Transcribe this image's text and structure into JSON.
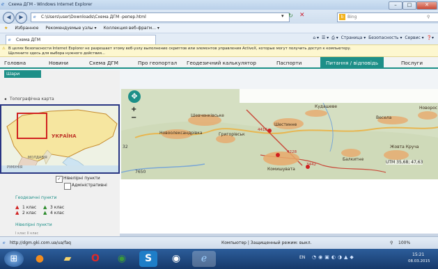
{
  "browser": {
    "title": "Схема ДГМ - Windows Internet Explorer",
    "url": "C:\\Users\\user\\Downloads\\Схема ДГМ -репер.html",
    "search_placeholder": "Bing",
    "favorites_label": "Избранное",
    "favorites_items": [
      "Рекомендуемые узлы ▾",
      "Коллекция веб-фрагм... ▾"
    ],
    "tab_title": "Схема ДГМ",
    "command_bar": [
      "Страница ▾",
      "Безопасность ▾",
      "Сервис ▾"
    ],
    "infobar_line1": "В целях безопасности Internet Explorer не разрешает этому веб-узлу выполнение скриптов или элементов управления ActiveX, которые могут получить доступ к компьютеру.",
    "infobar_line2": "Щелкните здесь для выбора нужного действия..."
  },
  "menu": {
    "items": [
      "Головна",
      "Новини",
      "Схема ДГМ",
      "Про геопортал",
      "Геодезичний калькулятор",
      "Паспорти",
      "Питання / відповідь",
      "Послуги"
    ],
    "active_index": 6
  },
  "sidebar": {
    "top_button": "Шари",
    "section": "Топографічна карта",
    "overview_label": "УКРАЇНА",
    "overview_labels": [
      "МОЛДАВІЯ",
      "РУМУНІЯ"
    ],
    "checkbox_1": "Нівелірні пункти",
    "checkbox_2": "Адміністративні",
    "legend_geo_title": "Геодезичні пункти",
    "legend_geo": [
      "1 клас",
      "3 клас",
      "2 клас",
      "4 клас"
    ],
    "legend_level_title": "Нівелірні пункти",
    "legend_level_cut": "I клас   II клас"
  },
  "map": {
    "places": [
      "Шевченківське",
      "Новоолександрівка",
      "Григорівськ",
      "Шестинне",
      "Кудашеве",
      "Весела",
      "Новорос",
      "Жовта Круча",
      "Комишувата",
      "Балкитне"
    ],
    "marks": [
      "4416",
      "4228",
      "3442"
    ],
    "coord_readout": "UTM 35,68; 47,63",
    "left_edge_mark": "32",
    "bottom_mark": "7650"
  },
  "status": {
    "url": "http://dgm.gki.com.ua/ua/faq",
    "zone": "Компьютер | Защищенный режим: выкл.",
    "zoom": "100%"
  },
  "taskbar": {
    "lang": "EN",
    "time": "15:21",
    "date": "08.03.2015"
  },
  "colors": {
    "accent": "#1d8f88",
    "overview_border": "#283582"
  }
}
